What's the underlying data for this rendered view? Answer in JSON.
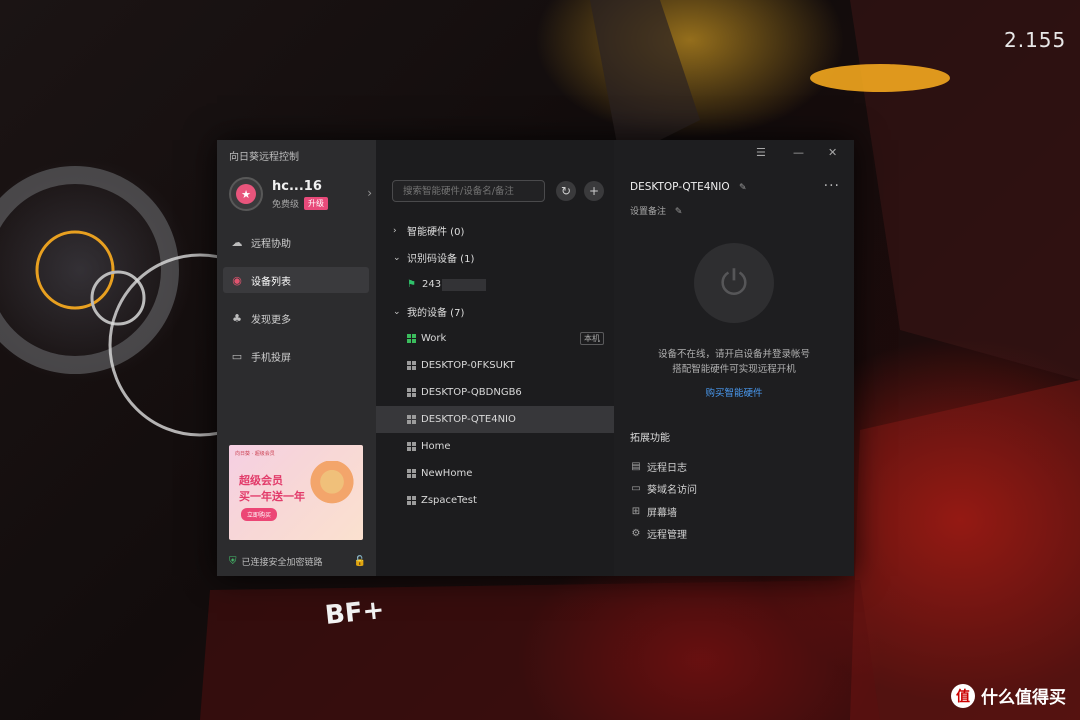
{
  "wallpaper": {
    "hud_number": "2.155",
    "logo_text": "BF+",
    "watermark": "什么值得买",
    "watermark_badge": "值"
  },
  "app": {
    "title": "向日葵远程控制",
    "window_controls": {
      "menu": "☰",
      "minimize": "—",
      "close": "✕"
    },
    "profile": {
      "username": "hc...16",
      "level": "免费级",
      "upgrade_label": "升级",
      "avatar_icon": "star-icon"
    },
    "nav": [
      {
        "label": "远程协助",
        "icon": "cloud-link-icon"
      },
      {
        "label": "设备列表",
        "icon": "device-list-icon",
        "active": true
      },
      {
        "label": "发现更多",
        "icon": "plant-icon"
      },
      {
        "label": "手机投屏",
        "icon": "monitor-icon"
      }
    ],
    "promo": {
      "top_text": "向日葵 · 超级会员",
      "line1": "超级会员",
      "line2": "买一年送一年",
      "button": "立即购买"
    },
    "security_status": "已连接安全加密链路",
    "search": {
      "placeholder": "搜索智能硬件/设备名/备注"
    },
    "groups": [
      {
        "label": "智能硬件 (0)",
        "expanded": false,
        "devices": []
      },
      {
        "label": "识别码设备 (1)",
        "expanded": true,
        "devices": [
          {
            "name": "243",
            "type": "code"
          }
        ]
      },
      {
        "label": "我的设备 (7)",
        "expanded": true,
        "devices": [
          {
            "name": "Work",
            "tag": "本机",
            "online": true
          },
          {
            "name": "DESKTOP-0FKSUKT"
          },
          {
            "name": "DESKTOP-QBDNGB6"
          },
          {
            "name": "DESKTOP-QTE4NIO",
            "selected": true
          },
          {
            "name": "Home"
          },
          {
            "name": "NewHome"
          },
          {
            "name": "ZspaceTest"
          }
        ]
      }
    ],
    "detail": {
      "device_name": "DESKTOP-QTE4NIO",
      "note_label": "设置备注",
      "offline_line1": "设备不在线，请开启设备并登录帐号",
      "offline_line2": "搭配智能硬件可实现远程开机",
      "buy_link": "购买智能硬件",
      "extensions_title": "拓展功能",
      "extensions": [
        {
          "label": "远程日志",
          "icon": "log-icon"
        },
        {
          "label": "葵域名访问",
          "icon": "browser-icon"
        },
        {
          "label": "屏幕墙",
          "icon": "grid-icon"
        },
        {
          "label": "远程管理",
          "icon": "gear-icon"
        }
      ]
    }
  }
}
